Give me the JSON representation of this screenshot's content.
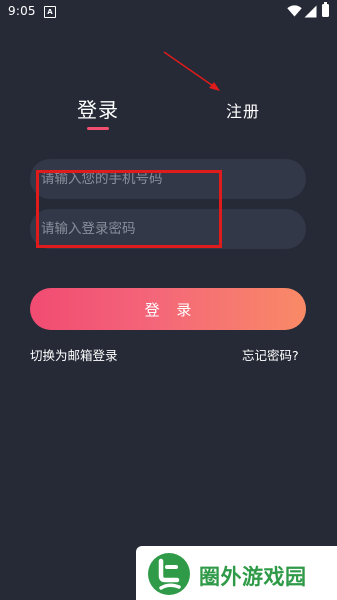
{
  "status_bar": {
    "time": "9:05",
    "notification_letter": "A"
  },
  "tabs": {
    "login": "登录",
    "register": "注册"
  },
  "form": {
    "phone_placeholder": "请输入您的手机号码",
    "password_placeholder": "请输入登录密码",
    "login_button": "登 录"
  },
  "links": {
    "email_login": "切换为邮箱登录",
    "forgot_password": "忘记密码?"
  },
  "watermark": {
    "text": "圈外游戏园"
  },
  "colors": {
    "background": "#262a37",
    "input_bg": "#333848",
    "accent": "#f0506e",
    "button_gradient_start": "#f14b72",
    "button_gradient_end": "#f98a66",
    "annotation": "#e01b1b",
    "watermark_green": "#2f9a47"
  },
  "icons": [
    "wifi-icon",
    "signal-icon",
    "battery-icon",
    "annotation-arrow-icon",
    "watermark-logo-icon"
  ]
}
